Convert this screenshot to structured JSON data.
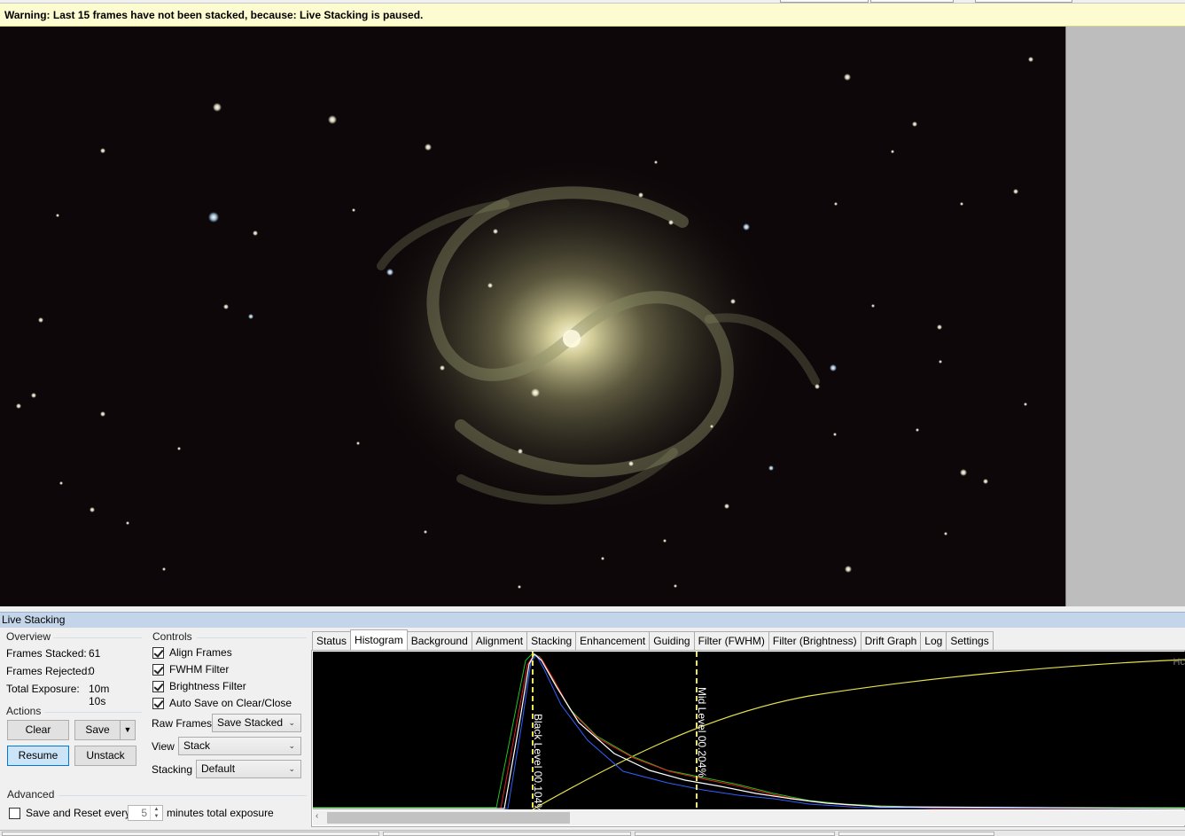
{
  "warning": {
    "text": "Warning: Last 15 frames have not been stacked, because: Live Stacking is paused."
  },
  "panel": {
    "title": "Live Stacking"
  },
  "overview": {
    "label": "Overview",
    "rows": [
      {
        "label": "Frames Stacked:",
        "value": "61"
      },
      {
        "label": "Frames Rejected:",
        "value": "0"
      },
      {
        "label": "Total Exposure:",
        "value": "10m 10s"
      }
    ]
  },
  "actions": {
    "label": "Actions",
    "clear": "Clear",
    "save": "Save",
    "resume": "Resume",
    "unstack": "Unstack"
  },
  "controls": {
    "label": "Controls",
    "checkboxes": [
      {
        "label": "Align Frames",
        "checked": true
      },
      {
        "label": "FWHM Filter",
        "checked": true
      },
      {
        "label": "Brightness Filter",
        "checked": true
      },
      {
        "label": "Auto Save on Clear/Close",
        "checked": true
      }
    ],
    "raw_frames": {
      "label": "Raw Frames",
      "value": "Save Stacked"
    },
    "view": {
      "label": "View",
      "value": "Stack"
    },
    "stacking": {
      "label": "Stacking",
      "value": "Default"
    }
  },
  "advanced": {
    "label": "Advanced",
    "save_reset_label": "Save and Reset every",
    "save_reset_checked": false,
    "save_reset_value": "5",
    "suffix": "minutes total exposure"
  },
  "tabs": [
    {
      "label": "Status",
      "selected": false
    },
    {
      "label": "Histogram",
      "selected": true
    },
    {
      "label": "Background",
      "selected": false
    },
    {
      "label": "Alignment",
      "selected": false
    },
    {
      "label": "Stacking",
      "selected": false
    },
    {
      "label": "Enhancement",
      "selected": false
    },
    {
      "label": "Guiding",
      "selected": false
    },
    {
      "label": "Filter (FWHM)",
      "selected": false
    },
    {
      "label": "Filter (Brightness)",
      "selected": false
    },
    {
      "label": "Drift Graph",
      "selected": false
    },
    {
      "label": "Log",
      "selected": false
    },
    {
      "label": "Settings",
      "selected": false
    }
  ],
  "histogram": {
    "black_level_label": "Black Level 00.104%",
    "mid_level_label": "Mid Level 00.204%",
    "corner_label": "Hc",
    "colors": {
      "red": "#e02020",
      "green": "#20c020",
      "blue": "#3060ff",
      "white": "#ffffff",
      "curve": "#e6e24a"
    }
  }
}
